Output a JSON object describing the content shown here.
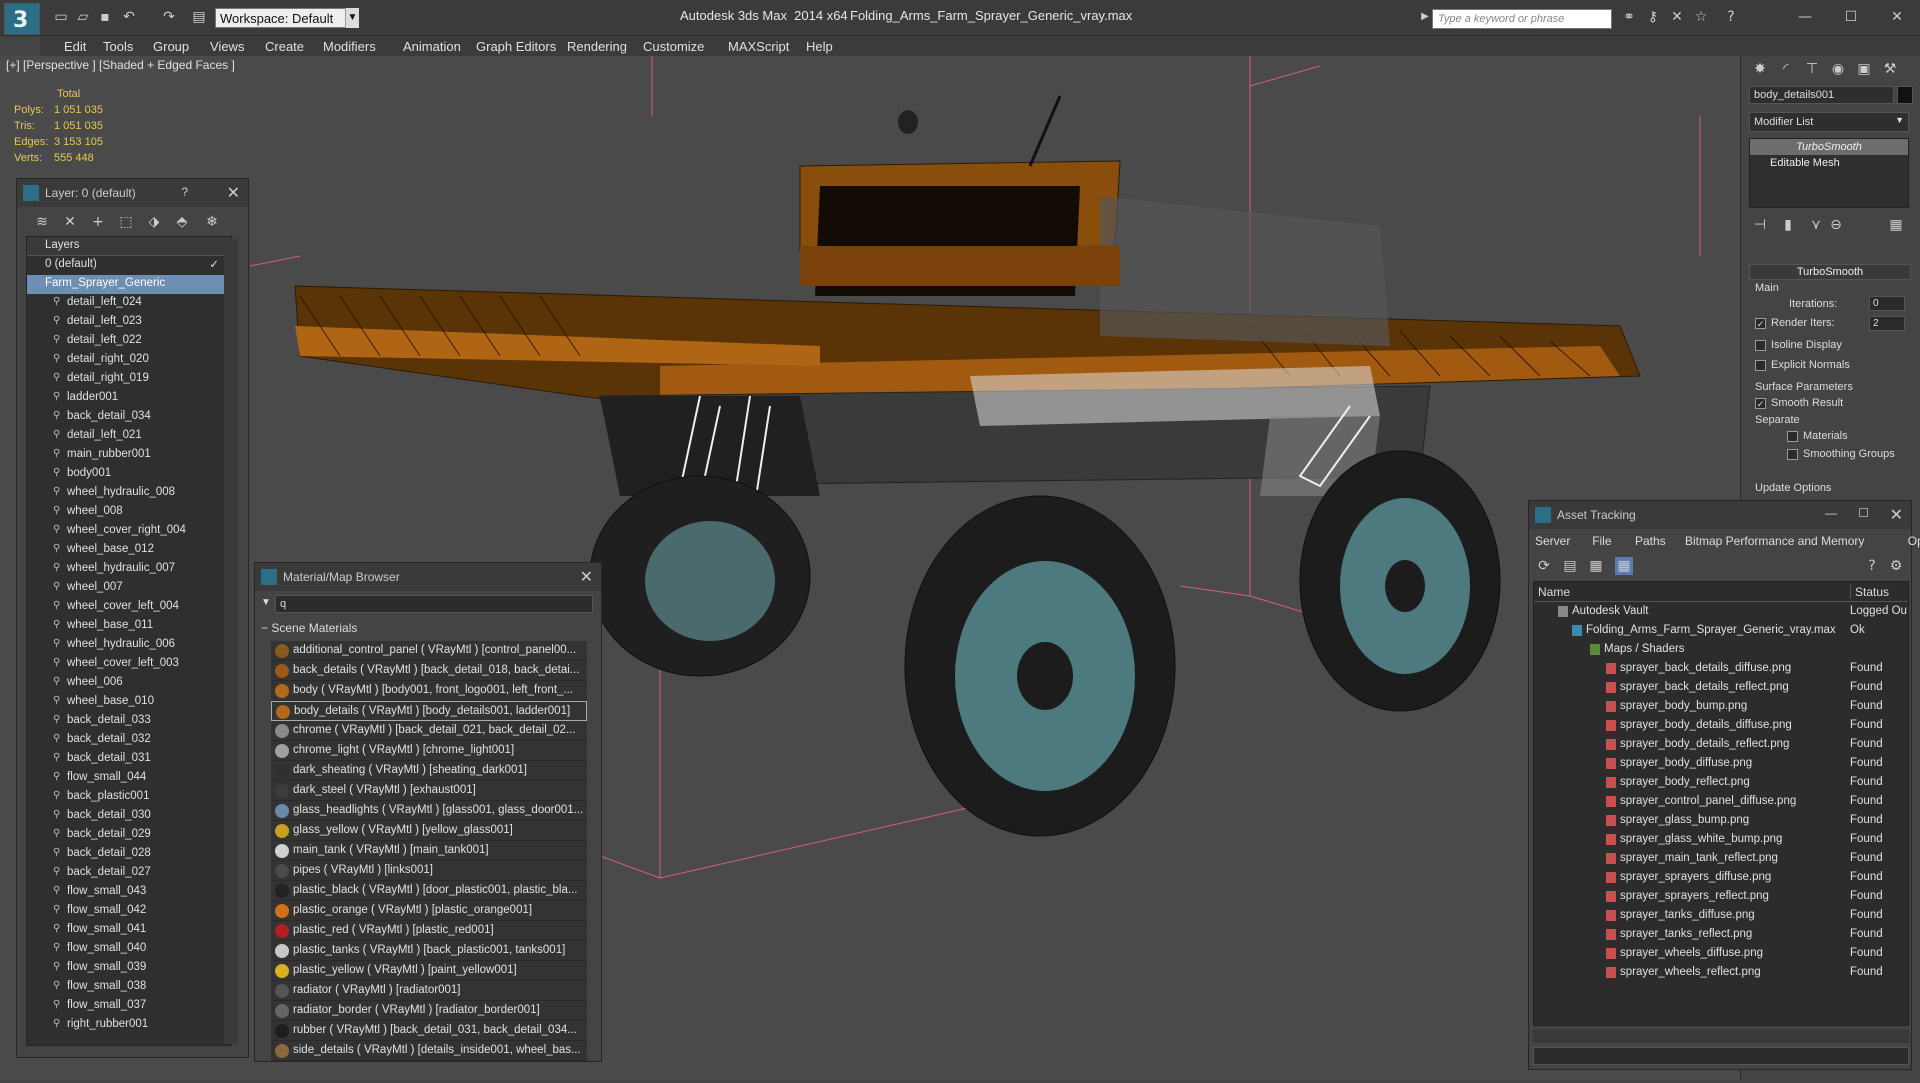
{
  "window": {
    "app_title": "Autodesk 3ds Max  2014 x64",
    "file_title": "Folding_Arms_Farm_Sprayer_Generic_vray.max",
    "workspace": "Workspace: Default",
    "search_placeholder": "Type a keyword or phrase"
  },
  "menu": [
    "Edit",
    "Tools",
    "Group",
    "Views",
    "Create",
    "Modifiers",
    "Animation",
    "Graph Editors",
    "Rendering",
    "Customize",
    "MAXScript",
    "Help"
  ],
  "viewport": {
    "label": "[+] [Perspective ] [Shaded + Edged Faces ]",
    "stats": {
      "header": "Total",
      "rows": [
        {
          "label": "Polys:",
          "value": "1 051 035"
        },
        {
          "label": "Tris:",
          "value": "1 051 035"
        },
        {
          "label": "Edges:",
          "value": "3 153 105"
        },
        {
          "label": "Verts:",
          "value": "555 448"
        }
      ]
    }
  },
  "layer_panel": {
    "title": "Layer: 0 (default)",
    "help": "?",
    "header": "Layers",
    "top": [
      "0 (default)",
      "Farm_Sprayer_Generic"
    ],
    "items": [
      "detail_left_024",
      "detail_left_023",
      "detail_left_022",
      "detail_right_020",
      "detail_right_019",
      "ladder001",
      "back_detail_034",
      "detail_left_021",
      "main_rubber001",
      "body001",
      "wheel_hydraulic_008",
      "wheel_008",
      "wheel_cover_right_004",
      "wheel_base_012",
      "wheel_hydraulic_007",
      "wheel_007",
      "wheel_cover_left_004",
      "wheel_base_011",
      "wheel_hydraulic_006",
      "wheel_cover_left_003",
      "wheel_006",
      "wheel_base_010",
      "back_detail_033",
      "back_detail_032",
      "back_detail_031",
      "flow_small_044",
      "back_plastic001",
      "back_detail_030",
      "back_detail_029",
      "back_detail_028",
      "back_detail_027",
      "flow_small_043",
      "flow_small_042",
      "flow_small_041",
      "flow_small_040",
      "flow_small_039",
      "flow_small_038",
      "flow_small_037",
      "right_rubber001"
    ]
  },
  "material_browser": {
    "title": "Material/Map Browser",
    "search": "q",
    "group": "Scene Materials",
    "items": [
      {
        "text": "additional_control_panel  ( VRayMtl ) [control_panel00...",
        "color": "#8a5a20"
      },
      {
        "text": "back_details  ( VRayMtl ) [back_detail_018, back_detai...",
        "color": "#9c5a18"
      },
      {
        "text": "body  ( VRayMtl ) [body001, front_logo001, left_front_...",
        "color": "#b06a1c"
      },
      {
        "text": "body_details  ( VRayMtl ) [body_details001, ladder001]",
        "color": "#b06a1c"
      },
      {
        "text": "chrome  ( VRayMtl ) [back_detail_021, back_detail_02...",
        "color": "#8a8a8a"
      },
      {
        "text": "chrome_light  ( VRayMtl ) [chrome_light001]",
        "color": "#a0a0a0"
      },
      {
        "text": "dark_sheating  ( VRayMtl ) [sheating_dark001]",
        "color": "#303030"
      },
      {
        "text": "dark_steel  ( VRayMtl ) [exhaust001]",
        "color": "#3c3c3c"
      },
      {
        "text": "glass_headlights ( VRayMtl ) [glass001, glass_door001...",
        "color": "#6b8aa8"
      },
      {
        "text": "glass_yellow  ( VRayMtl ) [yellow_glass001]",
        "color": "#c8a020"
      },
      {
        "text": "main_tank  ( VRayMtl ) [main_tank001]",
        "color": "#d0d0d0"
      },
      {
        "text": "pipes  ( VRayMtl ) [links001]",
        "color": "#4a4a4a"
      },
      {
        "text": "plastic_black  ( VRayMtl ) [door_plastic001, plastic_bla...",
        "color": "#222222"
      },
      {
        "text": "plastic_orange  ( VRayMtl ) [plastic_orange001]",
        "color": "#d07018"
      },
      {
        "text": "plastic_red  ( VRayMtl ) [plastic_red001]",
        "color": "#b02020"
      },
      {
        "text": "plastic_tanks  ( VRayMtl ) [back_plastic001, tanks001]",
        "color": "#c8c8c8"
      },
      {
        "text": "plastic_yellow  ( VRayMtl ) [paint_yellow001]",
        "color": "#d8b020"
      },
      {
        "text": "radiator  ( VRayMtl ) [radiator001]",
        "color": "#555555"
      },
      {
        "text": "radiator_border  ( VRayMtl ) [radiator_border001]",
        "color": "#666666"
      },
      {
        "text": "rubber  ( VRayMtl ) [back_detail_031, back_detail_034...",
        "color": "#1e1e1e"
      },
      {
        "text": "side_details  ( VRayMtl ) [details_inside001, wheel_bas...",
        "color": "#8a6a3a"
      }
    ]
  },
  "command_panel": {
    "object_name": "body_details001",
    "modifier_list": "Modifier List",
    "stack": [
      "TurboSmooth",
      "Editable Mesh"
    ],
    "rollout": "TurboSmooth",
    "main": "Main",
    "iterations_label": "Iterations:",
    "iterations": "0",
    "render_iters_label": "Render Iters:",
    "render_iters": "2",
    "isoline": "Isoline Display",
    "explicit_normals": "Explicit Normals",
    "surface_params": "Surface Parameters",
    "smooth_result": "Smooth Result",
    "separate": "Separate",
    "materials": "Materials",
    "smoothing_groups": "Smoothing Groups",
    "update_options": "Update Options"
  },
  "asset_tracking": {
    "title": "Asset Tracking",
    "menu": [
      "Server",
      "File",
      "Paths",
      "Bitmap Performance and Memory",
      "Options"
    ],
    "col_name": "Name",
    "col_status": "Status",
    "vault": {
      "name": "Autodesk Vault",
      "status": "Logged Ou"
    },
    "file": {
      "name": "Folding_Arms_Farm_Sprayer_Generic_vray.max",
      "status": "Ok"
    },
    "maps": "Maps / Shaders",
    "items": [
      {
        "name": "sprayer_back_details_diffuse.png",
        "status": "Found"
      },
      {
        "name": "sprayer_back_details_reflect.png",
        "status": "Found"
      },
      {
        "name": "sprayer_body_bump.png",
        "status": "Found"
      },
      {
        "name": "sprayer_body_details_diffuse.png",
        "status": "Found"
      },
      {
        "name": "sprayer_body_details_reflect.png",
        "status": "Found"
      },
      {
        "name": "sprayer_body_diffuse.png",
        "status": "Found"
      },
      {
        "name": "sprayer_body_reflect.png",
        "status": "Found"
      },
      {
        "name": "sprayer_control_panel_diffuse.png",
        "status": "Found"
      },
      {
        "name": "sprayer_glass_bump.png",
        "status": "Found"
      },
      {
        "name": "sprayer_glass_white_bump.png",
        "status": "Found"
      },
      {
        "name": "sprayer_main_tank_reflect.png",
        "status": "Found"
      },
      {
        "name": "sprayer_sprayers_diffuse.png",
        "status": "Found"
      },
      {
        "name": "sprayer_sprayers_reflect.png",
        "status": "Found"
      },
      {
        "name": "sprayer_tanks_diffuse.png",
        "status": "Found"
      },
      {
        "name": "sprayer_tanks_reflect.png",
        "status": "Found"
      },
      {
        "name": "sprayer_wheels_diffuse.png",
        "status": "Found"
      },
      {
        "name": "sprayer_wheels_reflect.png",
        "status": "Found"
      }
    ]
  }
}
